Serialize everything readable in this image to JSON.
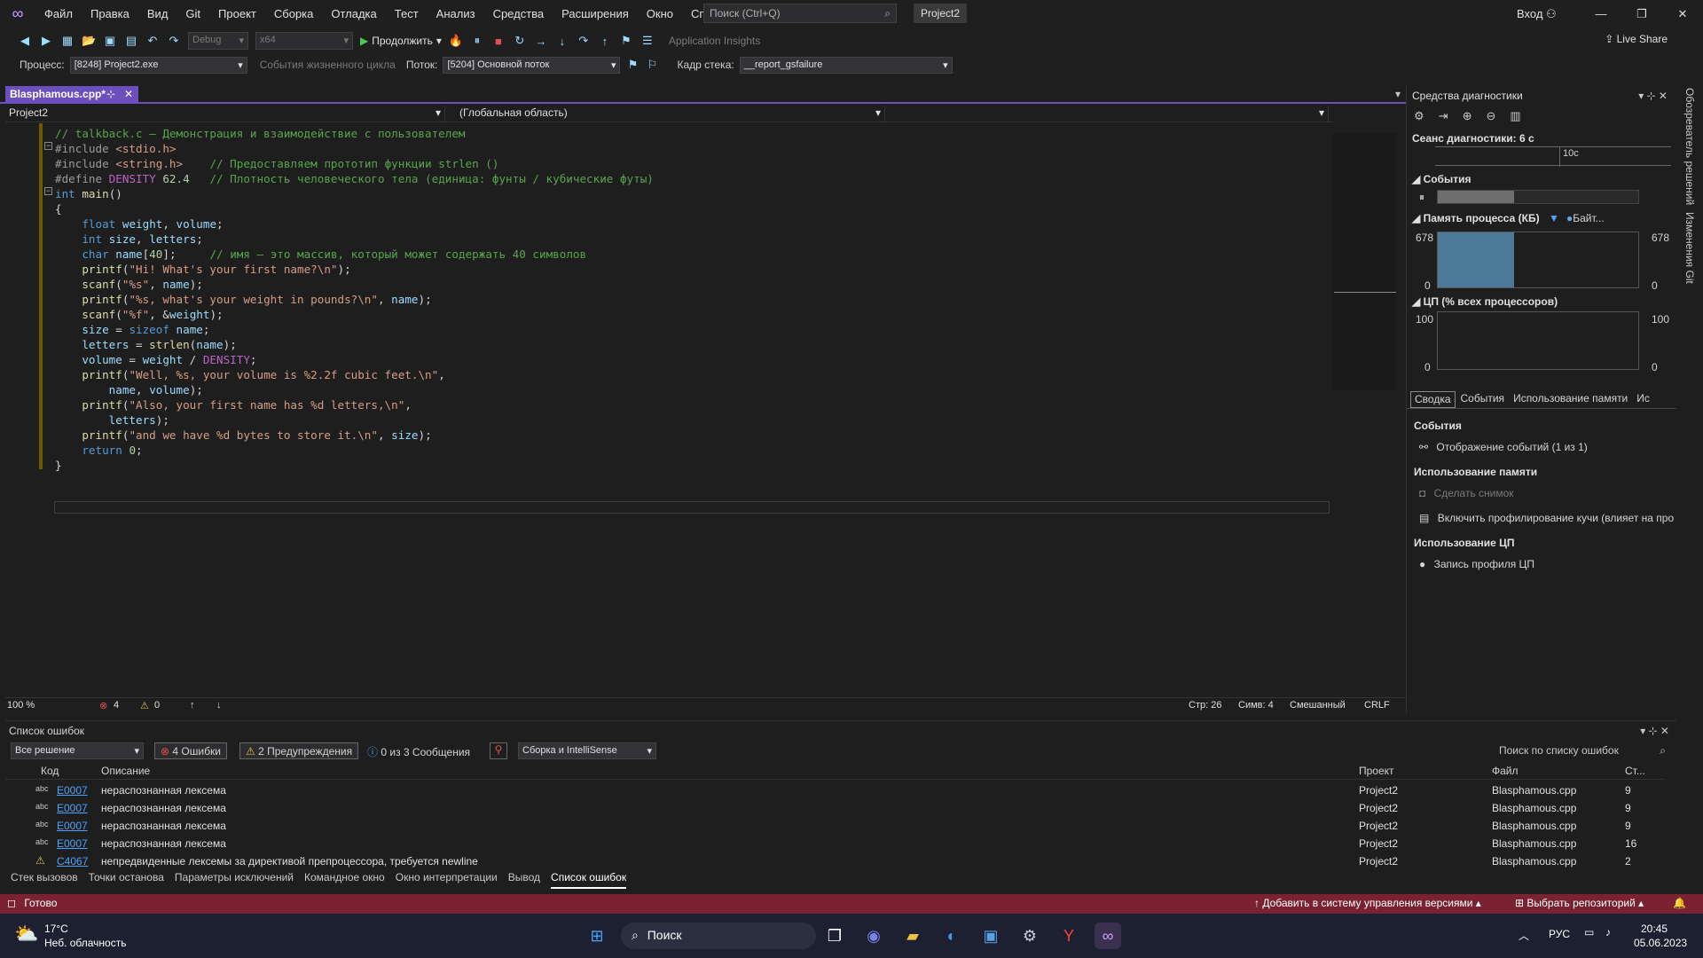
{
  "menu": {
    "items": [
      "Файл",
      "Правка",
      "Вид",
      "Git",
      "Проект",
      "Сборка",
      "Отладка",
      "Тест",
      "Анализ",
      "Средства",
      "Расширения",
      "Окно",
      "Справка"
    ],
    "search_placeholder": "Поиск (Ctrl+Q)",
    "project_badge": "Project2",
    "signin": "Вход"
  },
  "toolbar": {
    "config": "Debug",
    "platform": "x64",
    "continue_label": "Продолжить",
    "app_insights": "Application Insights",
    "live_share": "Live Share"
  },
  "debugbar": {
    "process_label": "Процесс:",
    "process_value": "[8248] Project2.exe",
    "lifecycle_label": "События жизненного цикла",
    "thread_label": "Поток:",
    "thread_value": "[5204] Основной поток",
    "stack_label": "Кадр стека:",
    "stack_value": "__report_gsfailure"
  },
  "editor": {
    "tab_name": "Blasphamous.cpp*",
    "nav_project": "Project2",
    "nav_scope": "(Глобальная область)",
    "lines": [
      {
        "t": "cm",
        "s": "// talkback.c – Демонстрация и взаимодействие с пользователем"
      },
      {
        "t": "mix",
        "s": "#include <stdio.h>"
      },
      {
        "t": "mix",
        "s": "#include <string.h>    // Предоставляем прототип функции strlen ()"
      },
      {
        "t": "mix",
        "s": "#define DENSITY 62.4   // Плотность человеческого тела (единица: фунты / кубические футы)"
      },
      {
        "t": "mix",
        "s": "int main()"
      },
      {
        "t": "mix",
        "s": "{"
      },
      {
        "t": "mix",
        "s": "    float weight, volume;"
      },
      {
        "t": "mix",
        "s": "    int size, letters;"
      },
      {
        "t": "mix",
        "s": "    char name[40];     // имя – это массив, который может содержать 40 символов"
      },
      {
        "t": "mix",
        "s": "    printf(\"Hi! What's your first name?\\n\");"
      },
      {
        "t": "mix",
        "s": "    scanf(\"%s\", name);"
      },
      {
        "t": "mix",
        "s": "    printf(\"%s, what's your weight in pounds?\\n\", name);"
      },
      {
        "t": "mix",
        "s": "    scanf(\"%f\", &weight);"
      },
      {
        "t": "mix",
        "s": "    size = sizeof name;"
      },
      {
        "t": "mix",
        "s": "    letters = strlen(name);"
      },
      {
        "t": "mix",
        "s": "    volume = weight / DENSITY;"
      },
      {
        "t": "mix",
        "s": "    printf(\"Well, %s, your volume is %2.2f cubic feet.\\n\","
      },
      {
        "t": "mix",
        "s": "        name, volume);"
      },
      {
        "t": "mix",
        "s": "    printf(\"Also, your first name has %d letters,\\n\","
      },
      {
        "t": "mix",
        "s": "        letters);"
      },
      {
        "t": "mix",
        "s": "    printf(\"and we have %d bytes to store it.\\n\", size);"
      },
      {
        "t": "mix",
        "s": "    return 0;"
      },
      {
        "t": "mix",
        "s": "}"
      }
    ],
    "zoom": "100 %",
    "errors_count": "4",
    "warnings_count": "0",
    "line": "Стр: 26",
    "col": "Симв: 4",
    "mode": "Смешанный",
    "eol": "CRLF"
  },
  "diagnostics": {
    "title": "Средства диагностики",
    "session": "Сеанс диагностики: 6 с",
    "timeline_label": "10с",
    "events": "События",
    "memory": "Память процесса (КБ)",
    "memory_legend": "Байт...",
    "memory_max": "678",
    "memory_min": "0",
    "cpu": "ЦП (% всех процессоров)",
    "cpu_max": "100",
    "cpu_min": "0",
    "tabs": [
      "Сводка",
      "События",
      "Использование памяти",
      "Ис"
    ],
    "s_events": "События",
    "s_events_item": "Отображение событий (1 из 1)",
    "s_memory": "Использование памяти",
    "s_memory_snap": "Сделать снимок",
    "s_memory_heap": "Включить профилирование кучи (влияет на про",
    "s_cpu": "Использование ЦП",
    "s_cpu_item": "Запись профиля ЦП"
  },
  "right_side": [
    "Обозреватель решений",
    "Изменения Git"
  ],
  "errorlist": {
    "title": "Список ошибок",
    "scope": "Все решение",
    "errors_btn": "4 Ошибки",
    "warnings_btn": "2 Предупреждения",
    "messages_btn": "0 из 3 Сообщения",
    "build_filter": "Сборка и IntelliSense",
    "search_placeholder": "Поиск по списку ошибок",
    "headers": {
      "code": "Код",
      "desc": "Описание",
      "project": "Проект",
      "file": "Файл",
      "line": "Ст..."
    },
    "rows": [
      {
        "code": "E0007",
        "desc": "нераспознанная лексема",
        "project": "Project2",
        "file": "Blasphamous.cpp",
        "line": "9",
        "kind": "error"
      },
      {
        "code": "E0007",
        "desc": "нераспознанная лексема",
        "project": "Project2",
        "file": "Blasphamous.cpp",
        "line": "9",
        "kind": "error"
      },
      {
        "code": "E0007",
        "desc": "нераспознанная лексема",
        "project": "Project2",
        "file": "Blasphamous.cpp",
        "line": "9",
        "kind": "error"
      },
      {
        "code": "E0007",
        "desc": "нераспознанная лексема",
        "project": "Project2",
        "file": "Blasphamous.cpp",
        "line": "16",
        "kind": "error"
      },
      {
        "code": "C4067",
        "desc": "непредвиденные лексемы за директивой препроцессора, требуется newline",
        "project": "Project2",
        "file": "Blasphamous.cpp",
        "line": "2",
        "kind": "warning"
      }
    ]
  },
  "bottom_tabs": [
    "Стек вызовов",
    "Точки останова",
    "Параметры исключений",
    "Командное окно",
    "Окно интерпретации",
    "Вывод",
    "Список ошибок"
  ],
  "status": {
    "ready": "Готово",
    "vcs": "Добавить в систему управления версиями",
    "repo": "Выбрать репозиторий"
  },
  "taskbar": {
    "temp": "17°C",
    "weather": "Неб. облачность",
    "search": "Поиск",
    "lang": "РУС",
    "time": "20:45",
    "date": "05.06.2023"
  }
}
